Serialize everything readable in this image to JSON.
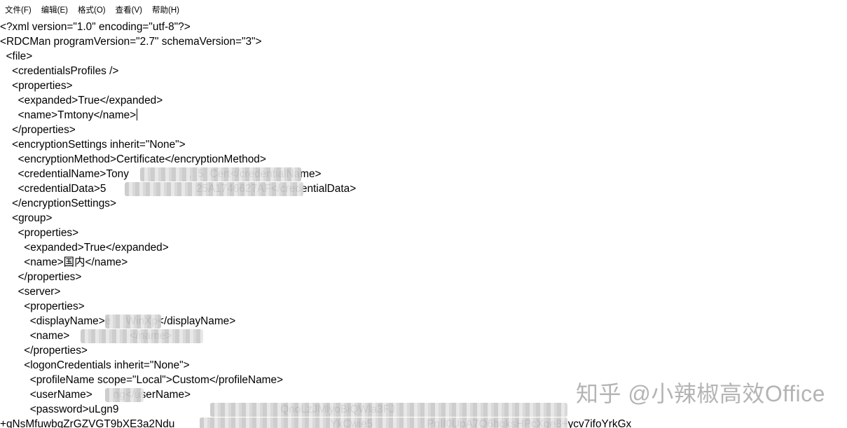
{
  "menu": {
    "file": "文件(F)",
    "edit": "编辑(E)",
    "format": "格式(O)",
    "view": "查看(V)",
    "help": "帮助(H)"
  },
  "lines": [
    "<?xml version=\"1.0\" encoding=\"utf-8\"?>",
    "<RDCMan programVersion=\"2.7\" schemaVersion=\"3\">",
    "  <file>",
    "    <credentialsProfiles />",
    "    <properties>",
    "      <expanded>True</expanded>",
    "      <name>Tmtony</name>",
    "    </properties>",
    "    <encryptionSettings inherit=\"None\">",
    "      <encryptionMethod>Certificate</encryptionMethod>",
    "      <credentialName>Tony                    ,  5  Cert</credentialName>",
    "      <credentialData>5                              25A1746627AF</credentialData>",
    "    </encryptionSettings>",
    "    <group>",
    "      <properties>",
    "        <expanded>True</expanded>",
    "        <name>国内</name>",
    "      </properties>",
    "      <server>",
    "        <properties>",
    "          <displayName>e     WinXp</displayName>",
    "          <name>                    </name>",
    "        </properties>",
    "        <logonCredentials inherit=\"None\">",
    "          <profileName scope=\"Local\">Custom</profileName>",
    "          <userName>       ng</userName>",
    "          <password>uLgn9                                                      QnoLzJMlyoBiQWla3FJ",
    "+qNsMfuwbqZrGZVGT9bXE3a2Ndu                                                    YkCwie5                  PqII0UpA7O6hqksHPcXqe8+ycv7ifoYrkGx"
  ],
  "watermark": "知乎 @小辣椒高效Office"
}
